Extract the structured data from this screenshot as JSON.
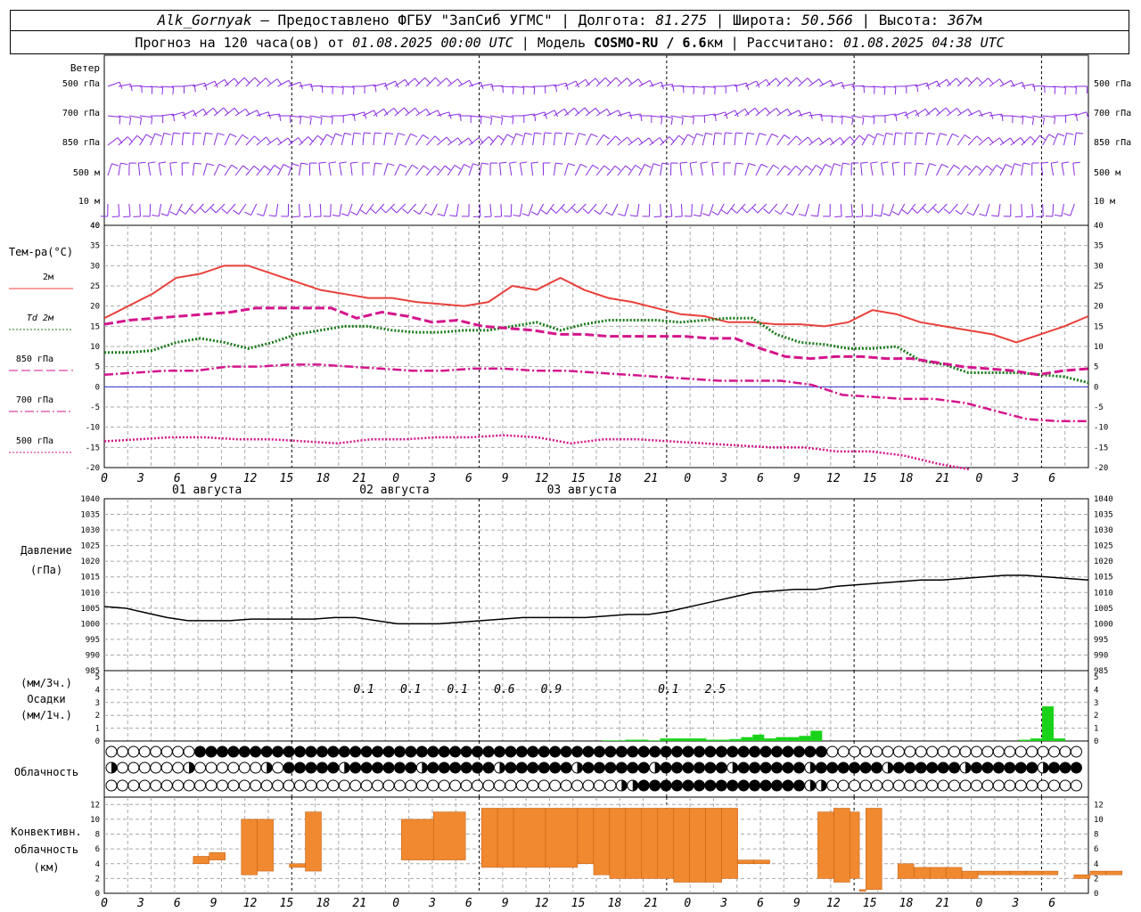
{
  "header": {
    "station": "Alk_Gornyak",
    "provider": " – Предоставлено ФГБУ \"ЗапСиб УГМС\" | Долгота: ",
    "lon": "81.275",
    "lat_label": " | Широта: ",
    "lat": "50.566",
    "alt_label": " | Высота: ",
    "alt": "367",
    "alt_unit": "м",
    "forecast_label": "Прогноз на 120 часа(ов) от ",
    "start": "01.08.2025 00:00 UTC",
    "model_label": " | Модель ",
    "model": "COSMO-RU / 6.6",
    "model_unit": "км",
    "calc_label": " | Рассчитано: ",
    "calc": "01.08.2025 04:38 UTC"
  },
  "wind_panel": {
    "title": "Ветер",
    "levels": [
      "500 гПа",
      "700 гПа",
      "850 гПа",
      "500 м",
      "10  м"
    ]
  },
  "temp_panel": {
    "title": "Тем-ра(°C)",
    "legend": [
      {
        "name": "2м",
        "color": "#e8413b",
        "dash": "solid"
      },
      {
        "name": "Td  2м",
        "color": "#1a7a1a",
        "dash": "dotted"
      },
      {
        "name": "850 гПа",
        "color": "#d4158c",
        "dash": "long-dash"
      },
      {
        "name": "700 гПа",
        "color": "#d4158c",
        "dash": "dash-dot"
      },
      {
        "name": "500 гПа",
        "color": "#d4158c",
        "dash": "dotted"
      }
    ],
    "yticks": [
      "40",
      "35",
      "30",
      "25",
      "20",
      "15",
      "10",
      "5",
      "0",
      "-5",
      "-10",
      "-15",
      "-20"
    ]
  },
  "hour_ticks": [
    "0",
    "3",
    "6",
    "9",
    "12",
    "15",
    "18",
    "21",
    "0",
    "3",
    "6",
    "9",
    "12",
    "15",
    "18",
    "21",
    "0",
    "3",
    "6",
    "9",
    "12",
    "15",
    "18",
    "21",
    "0",
    "3",
    "6"
  ],
  "date_labels": [
    "01 августа",
    "02 августа",
    "03 августа"
  ],
  "pressure_panel": {
    "title": "Давление",
    "unit": "(гПа)",
    "yticks": [
      "1040",
      "1035",
      "1030",
      "1025",
      "1020",
      "1015",
      "1010",
      "1005",
      "1000",
      "995",
      "990",
      "985"
    ]
  },
  "precip_panel": {
    "unit3": "(мм/3ч.)",
    "title": "Осадки",
    "unit1": "(мм/1ч.)",
    "yticks": [
      "5",
      "4",
      "3",
      "2",
      "1",
      "0"
    ],
    "totals": [
      "0.1",
      "0.1",
      "0.1",
      "0.6",
      "0.9",
      "0.1",
      "2.5"
    ]
  },
  "cloud_panel": {
    "title": "Облачность"
  },
  "conv_panel": {
    "title1": "Конвективн.",
    "title2": "облачность",
    "unit": "(км)",
    "yticks": [
      "12",
      "10",
      "8",
      "6",
      "4",
      "2",
      "0"
    ]
  },
  "colors": {
    "t2m": "#e8413b",
    "td": "#1a7a1a",
    "upper": "#d4158c",
    "wind": "#8a2be2",
    "precip": "#19d319",
    "conv": "#f0892f",
    "zero_line": "#3333cc"
  },
  "chart_data": [
    {
      "type": "line",
      "title": "Тем-ра(°C)",
      "xlabel": "",
      "ylabel": "Тем-ра(°C)",
      "ylim": [
        -20,
        40
      ],
      "x_hours": [
        0,
        3,
        6,
        9,
        12,
        15,
        18,
        21,
        24,
        27,
        30,
        33,
        36,
        39,
        42,
        45,
        48,
        51,
        54,
        57,
        60,
        63,
        66,
        69,
        72,
        75,
        78,
        81,
        84,
        87,
        90,
        93,
        96,
        99,
        102,
        105,
        108,
        111,
        114,
        117,
        120
      ],
      "series": [
        {
          "name": "2м",
          "values": [
            17,
            20,
            23,
            27,
            28,
            30,
            30,
            28,
            26,
            24,
            23,
            22,
            22,
            21,
            20.5,
            20,
            21,
            25,
            24,
            27,
            24,
            22,
            21,
            19.5,
            18,
            17.5,
            16,
            16,
            15.5,
            15.5,
            15,
            16,
            19,
            18,
            16,
            15,
            14,
            13,
            11,
            13,
            15,
            17.5
          ]
        },
        {
          "name": "Td  2м",
          "values": [
            8.5,
            8.5,
            9,
            11,
            12,
            11,
            9.5,
            11,
            13,
            14,
            15,
            15,
            14,
            13.5,
            13.5,
            14,
            14,
            15,
            16,
            14,
            15.5,
            16.5,
            16.5,
            16.5,
            16,
            16.5,
            17,
            17,
            13,
            11,
            10.5,
            9.5,
            9.5,
            10,
            6.5,
            5.5,
            3.5,
            3.5,
            3.5,
            3,
            2.5,
            1
          ]
        },
        {
          "name": "850 гПа",
          "values": [
            15.5,
            16.5,
            17,
            17.5,
            18,
            18.5,
            19.5,
            19.5,
            19.5,
            19.5,
            17,
            18.5,
            17.5,
            16,
            16.5,
            15,
            14.5,
            14,
            13,
            13,
            12.5,
            12.5,
            12.5,
            12.5,
            12,
            12,
            9.5,
            7.5,
            7,
            7.5,
            7.5,
            7,
            7,
            6,
            5,
            4.5,
            4,
            3,
            4,
            4.5
          ]
        },
        {
          "name": "700 гПа",
          "values": [
            3,
            3.5,
            4,
            4,
            5,
            5,
            5.5,
            5.5,
            5,
            4.5,
            4,
            4,
            4.5,
            4.5,
            4,
            4,
            3.5,
            3,
            2.5,
            2,
            1.5,
            1.5,
            1.5,
            0.5,
            -2,
            -2.5,
            -3,
            -3,
            -4,
            -6,
            -8,
            -8.5,
            -8.5
          ]
        },
        {
          "name": "500 гПа",
          "values": [
            -13.5,
            -13,
            -12.5,
            -12.5,
            -13,
            -13,
            -13.5,
            -14,
            -13,
            -13,
            -12.5,
            -12.5,
            -12,
            -12.5,
            -14,
            -13,
            -13,
            -13.5,
            -14,
            -14.5,
            -15,
            -15,
            -16,
            -16,
            -17,
            -19,
            -21
          ]
        }
      ]
    },
    {
      "type": "line",
      "title": "Давление",
      "ylabel": "Давление (гПа)",
      "ylim": [
        985,
        1040
      ],
      "series": [
        {
          "name": "Давление",
          "values": [
            1005.5,
            1005,
            1003.5,
            1002,
            1001,
            1001,
            1001,
            1001.5,
            1001.5,
            1001.5,
            1001.5,
            1002,
            1002,
            1001,
            1000,
            1000,
            1000,
            1000.5,
            1001,
            1001.5,
            1002,
            1002,
            1002,
            1002,
            1002.5,
            1003,
            1003,
            1004,
            1005.5,
            1007,
            1008.5,
            1010,
            1010.5,
            1011,
            1011,
            1012,
            1012.5,
            1013,
            1013.5,
            1014,
            1014,
            1014.5,
            1015,
            1015.5,
            1015.5,
            1015,
            1014.5,
            1014
          ]
        }
      ]
    },
    {
      "type": "bar",
      "title": "Осадки",
      "ylabel": "(мм/1ч.)",
      "ylim": [
        0,
        5
      ],
      "series": [
        {
          "name": "Осадки",
          "values": [
            0,
            0,
            0,
            0,
            0,
            0,
            0,
            0,
            0,
            0,
            0,
            0,
            0,
            0,
            0,
            0,
            0,
            0,
            0,
            0,
            0,
            0,
            0,
            0,
            0,
            0,
            0,
            0,
            0,
            0,
            0,
            0,
            0,
            0,
            0,
            0,
            0,
            0,
            0,
            0,
            0,
            0,
            0,
            0.05,
            0.05,
            0.1,
            0.1,
            0.05,
            0.2,
            0.2,
            0.2,
            0.2,
            0.1,
            0.1,
            0.15,
            0.3,
            0.5,
            0.2,
            0.3,
            0.3,
            0.4,
            0.8,
            0,
            0,
            0,
            0,
            0,
            0,
            0,
            0,
            0,
            0,
            0,
            0,
            0,
            0,
            0,
            0,
            0,
            0.1,
            0.2,
            2.7,
            0.2,
            0,
            0
          ]
        }
      ]
    },
    {
      "type": "bar",
      "title": "Конвективн. облачность",
      "ylabel": "(км)",
      "ylim": [
        0,
        13
      ],
      "bars": [
        {
          "x0": 6,
          "x1": 7,
          "lo": 4,
          "hi": 5
        },
        {
          "x0": 7,
          "x1": 8,
          "lo": 4.5,
          "hi": 5.5
        },
        {
          "x0": 9,
          "x1": 10,
          "lo": 2.5,
          "hi": 10
        },
        {
          "x0": 10,
          "x1": 11,
          "lo": 3,
          "hi": 10
        },
        {
          "x0": 12,
          "x1": 13,
          "lo": 3.5,
          "hi": 4
        },
        {
          "x0": 13,
          "x1": 14,
          "lo": 3,
          "hi": 11
        },
        {
          "x0": 19,
          "x1": 21,
          "lo": 4.5,
          "hi": 10
        },
        {
          "x0": 21,
          "x1": 23,
          "lo": 4.5,
          "hi": 11
        },
        {
          "x0": 24,
          "x1": 25,
          "lo": 3.5,
          "hi": 11.5
        },
        {
          "x0": 25,
          "x1": 26,
          "lo": 3.5,
          "hi": 11.5
        },
        {
          "x0": 26,
          "x1": 28,
          "lo": 3.5,
          "hi": 11.5
        },
        {
          "x0": 28,
          "x1": 30,
          "lo": 3.5,
          "hi": 11.5
        },
        {
          "x0": 30,
          "x1": 31,
          "lo": 4,
          "hi": 11.5
        },
        {
          "x0": 31,
          "x1": 32,
          "lo": 2.5,
          "hi": 11.5
        },
        {
          "x0": 32,
          "x1": 33,
          "lo": 2,
          "hi": 11.5
        },
        {
          "x0": 33,
          "x1": 34,
          "lo": 2,
          "hi": 11.5
        },
        {
          "x0": 34,
          "x1": 35,
          "lo": 2,
          "hi": 11.5
        },
        {
          "x0": 35,
          "x1": 36,
          "lo": 2,
          "hi": 11.5
        },
        {
          "x0": 36,
          "x1": 37,
          "lo": 1.5,
          "hi": 11.5
        },
        {
          "x0": 37,
          "x1": 38,
          "lo": 1.5,
          "hi": 11.5
        },
        {
          "x0": 38,
          "x1": 39,
          "lo": 1.5,
          "hi": 11.5
        },
        {
          "x0": 39,
          "x1": 40,
          "lo": 2,
          "hi": 11.5
        },
        {
          "x0": 40,
          "x1": 41,
          "lo": 4,
          "hi": 4.5
        },
        {
          "x0": 41,
          "x1": 42,
          "lo": 4,
          "hi": 4.5
        },
        {
          "x0": 45,
          "x1": 46,
          "lo": 2,
          "hi": 11
        },
        {
          "x0": 46,
          "x1": 47,
          "lo": 1.5,
          "hi": 11.5
        },
        {
          "x0": 47,
          "x1": 47.6,
          "lo": 2,
          "hi": 11
        },
        {
          "x0": 47.6,
          "x1": 48,
          "lo": 0.5,
          "hi": 0.5
        },
        {
          "x0": 48,
          "x1": 49,
          "lo": 0.5,
          "hi": 11.5
        },
        {
          "x0": 50,
          "x1": 51,
          "lo": 2,
          "hi": 4
        },
        {
          "x0": 51,
          "x1": 52,
          "lo": 2,
          "hi": 3.5
        },
        {
          "x0": 52,
          "x1": 53,
          "lo": 2,
          "hi": 3.5
        },
        {
          "x0": 53,
          "x1": 54,
          "lo": 2,
          "hi": 3.5
        },
        {
          "x0": 54,
          "x1": 55,
          "lo": 2,
          "hi": 3
        },
        {
          "x0": 55,
          "x1": 56,
          "lo": 2.5,
          "hi": 3
        },
        {
          "x0": 56,
          "x1": 57,
          "lo": 2.5,
          "hi": 3
        },
        {
          "x0": 57,
          "x1": 58,
          "lo": 2.5,
          "hi": 3
        },
        {
          "x0": 58,
          "x1": 59,
          "lo": 2.5,
          "hi": 3
        },
        {
          "x0": 59,
          "x1": 60,
          "lo": 2.5,
          "hi": 3
        },
        {
          "x0": 61,
          "x1": 62,
          "lo": 2,
          "hi": 2.5
        },
        {
          "x0": 62,
          "x1": 63,
          "lo": 2.5,
          "hi": 3
        },
        {
          "x0": 63,
          "x1": 64,
          "lo": 2.5,
          "hi": 3
        },
        {
          "x0": 69,
          "x1": 73,
          "lo": 2.5,
          "hi": 3
        },
        {
          "x0": 83,
          "x1": 84,
          "lo": 2,
          "hi": 3.5
        },
        {
          "x0": 84,
          "x1": 85,
          "lo": 2.5,
          "hi": 4
        },
        {
          "x0": 85,
          "x1": 86,
          "lo": 2.5,
          "hi": 4
        },
        {
          "x0": 86,
          "x1": 87,
          "lo": 2.5,
          "hi": 4
        }
      ]
    }
  ]
}
